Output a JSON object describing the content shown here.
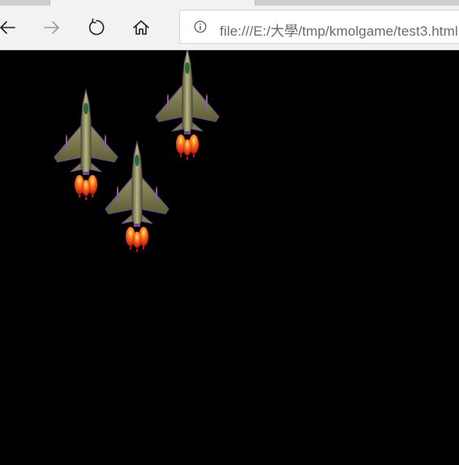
{
  "browser": {
    "address_bar": {
      "url": "file:///E:/大學/tmp/kmolgame/test3.html"
    },
    "toolbar": {
      "back": "back-arrow-icon",
      "forward": "forward-arrow-icon",
      "refresh": "refresh-icon",
      "home": "home-icon",
      "site_info": "info-icon"
    }
  },
  "game": {
    "background_color": "#000000",
    "sprites": [
      "fighter-jet-sprite",
      "fighter-jet-sprite",
      "fighter-jet-sprite"
    ]
  }
}
